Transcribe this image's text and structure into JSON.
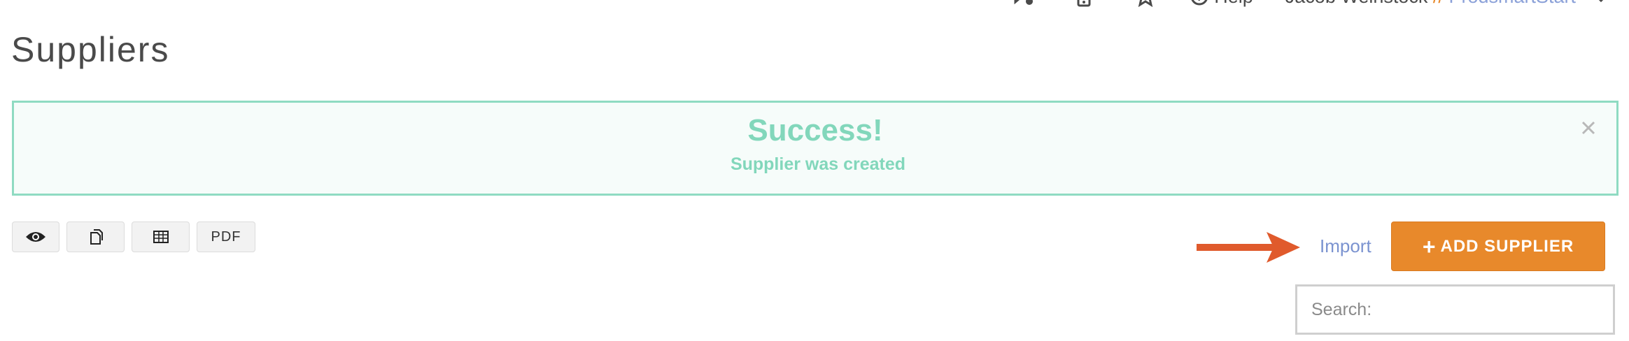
{
  "topnav": {
    "help_label": "Help",
    "user_name": "Jacob Weinstock",
    "separator": "//",
    "company_name": "ProdsmartStart"
  },
  "page": {
    "title": "Suppliers"
  },
  "alert": {
    "heading": "Success!",
    "message": "Supplier was created",
    "close_symbol": "×",
    "color": "#82d7bb"
  },
  "export_buttons": {
    "view_icon": "eye-icon",
    "copy_icon": "copy-icon",
    "csv_icon": "table-icon",
    "pdf_label": "PDF"
  },
  "actions": {
    "import_label": "Import",
    "add_label": "ADD SUPPLIER",
    "add_icon": "plus-icon",
    "accent_color": "#e8892b",
    "link_color": "#7b93d0"
  },
  "search": {
    "placeholder": "Search:",
    "value": ""
  }
}
